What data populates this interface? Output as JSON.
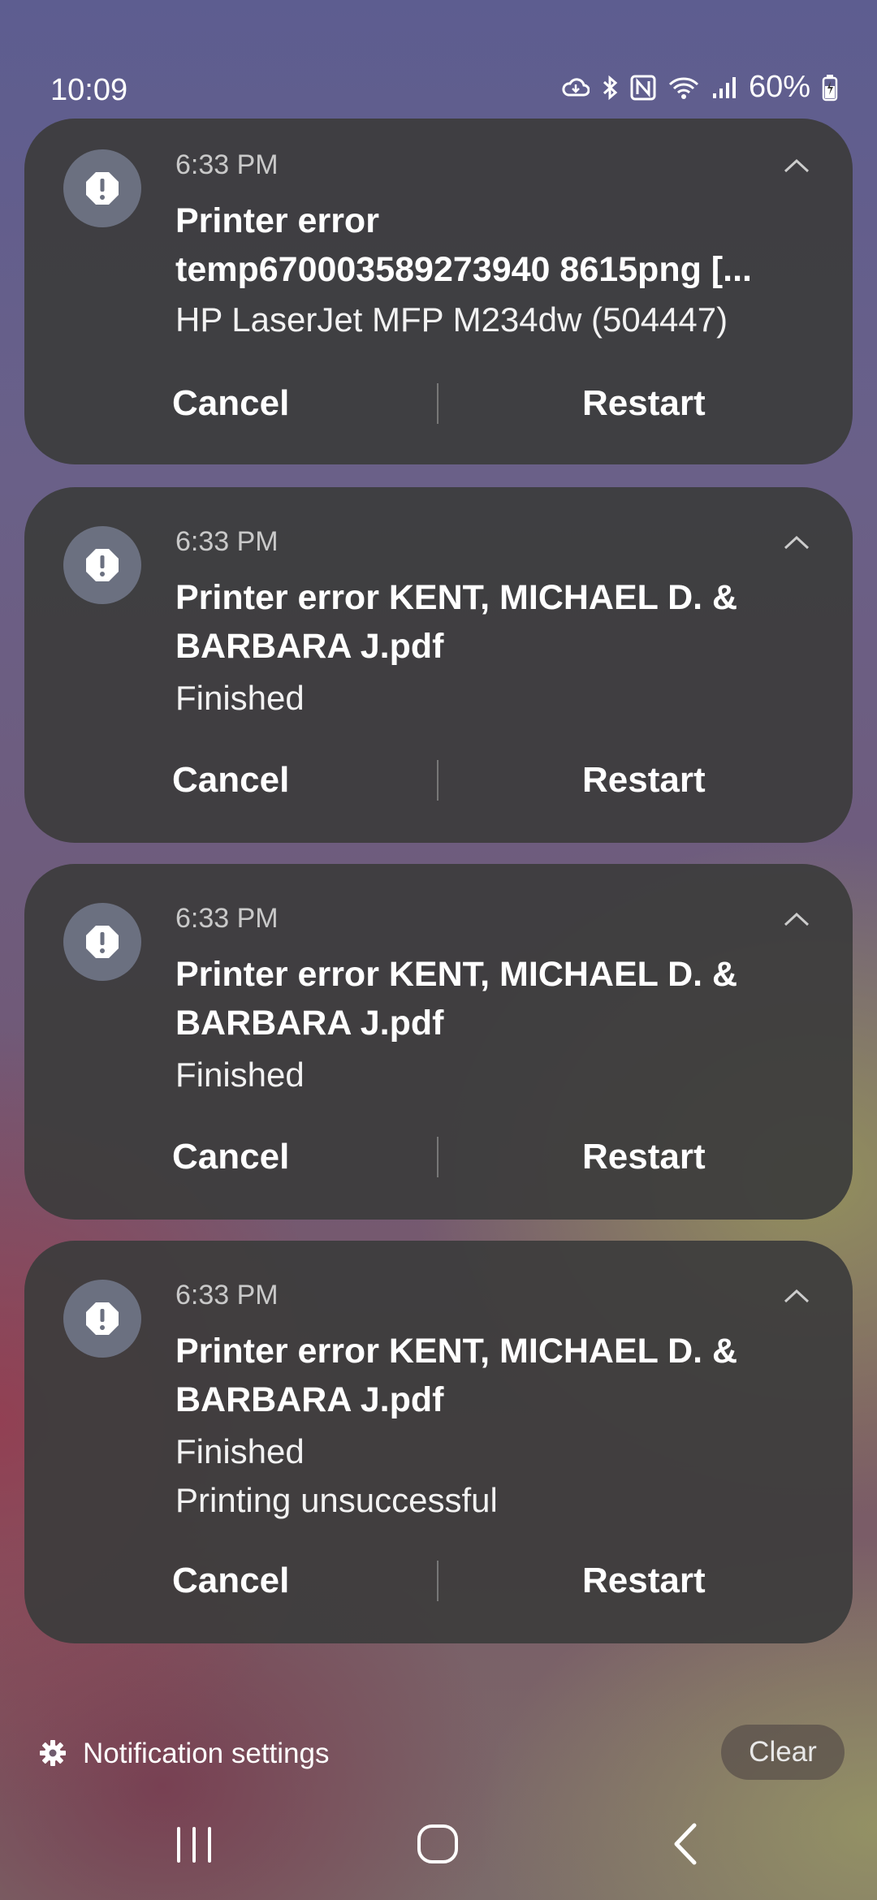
{
  "status": {
    "time": "10:09",
    "battery": "60%",
    "icons": [
      "cloud-sync-icon",
      "bluetooth-icon",
      "nfc-icon",
      "wifi-icon",
      "signal-icon",
      "battery-icon"
    ]
  },
  "notifications": [
    {
      "time": "6:33 PM",
      "title_lines": [
        "Printer error",
        "temp670003589273940 8615png [..."
      ],
      "lines": [
        "HP LaserJet MFP M234dw (504447)"
      ],
      "cancel": "Cancel",
      "restart": "Restart"
    },
    {
      "time": "6:33 PM",
      "title_lines": [
        "Printer error KENT, MICHAEL D. &",
        "BARBARA J.pdf"
      ],
      "lines": [
        "Finished"
      ],
      "cancel": "Cancel",
      "restart": "Restart"
    },
    {
      "time": "6:33 PM",
      "title_lines": [
        "Printer error KENT, MICHAEL D. &",
        "BARBARA J.pdf"
      ],
      "lines": [
        "Finished"
      ],
      "cancel": "Cancel",
      "restart": "Restart"
    },
    {
      "time": "6:33 PM",
      "title_lines": [
        "Printer error KENT, MICHAEL D. &",
        "BARBARA J.pdf"
      ],
      "lines": [
        "Finished",
        "Printing unsuccessful"
      ],
      "cancel": "Cancel",
      "restart": "Restart"
    }
  ],
  "footer": {
    "settings_label": "Notification settings",
    "clear_label": "Clear"
  },
  "navbar": [
    "recent-apps-icon",
    "home-icon",
    "back-icon"
  ]
}
